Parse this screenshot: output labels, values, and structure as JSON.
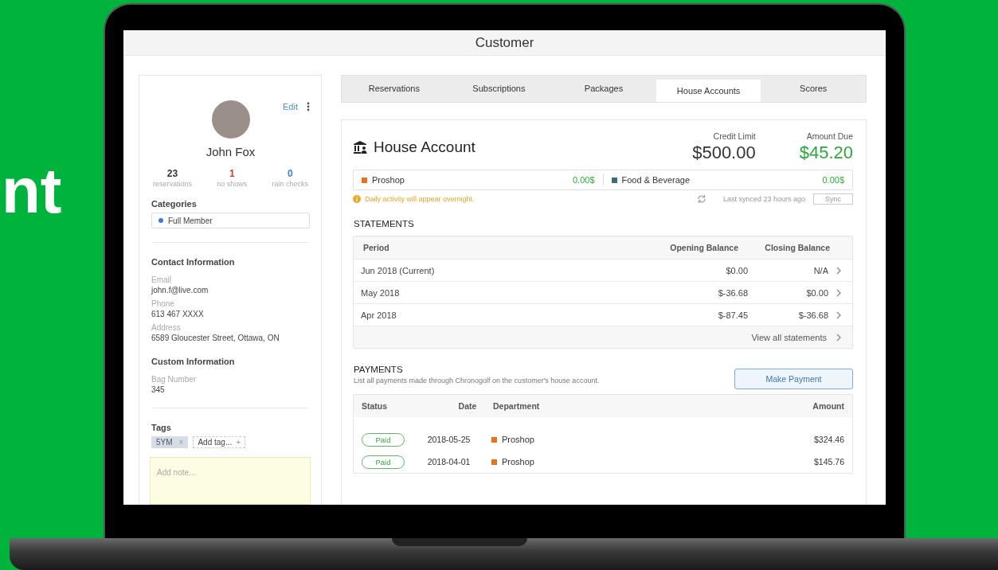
{
  "background": {
    "headline": "nt"
  },
  "window": {
    "title": "Customer"
  },
  "profile": {
    "edit_label": "Edit",
    "name": "John Fox",
    "stats": [
      {
        "value": "23",
        "label": "reservations",
        "color": "#333333"
      },
      {
        "value": "1",
        "label": "no shows",
        "color": "#d23a2f"
      },
      {
        "value": "0",
        "label": "rain checks",
        "color": "#3a86c8"
      }
    ]
  },
  "categories": {
    "title": "Categories",
    "items": [
      {
        "label": "Full Member",
        "color": "#3a7bd5"
      }
    ]
  },
  "contact": {
    "title": "Contact Information",
    "fields": [
      {
        "label": "Email",
        "value": "john.f@live.com"
      },
      {
        "label": "Phone",
        "value": "613 467 XXXX"
      },
      {
        "label": "Address",
        "value": "6589 Gloucester Street, Ottawa, ON"
      }
    ]
  },
  "custom": {
    "title": "Custom Information",
    "fields": [
      {
        "label": "Bag Number",
        "value": "345"
      }
    ]
  },
  "tags": {
    "title": "Tags",
    "items": [
      {
        "label": "5YM",
        "remove": "×"
      }
    ],
    "add_label": "Add tag...",
    "add_icon": "+"
  },
  "note": {
    "placeholder": "Add note..."
  },
  "tabs": [
    {
      "label": "Reservations",
      "selected": false
    },
    {
      "label": "Subscriptions",
      "selected": false
    },
    {
      "label": "Packages",
      "selected": false
    },
    {
      "label": "House Accounts",
      "selected": true
    },
    {
      "label": "Scores",
      "selected": false
    }
  ],
  "account": {
    "title": "House Account",
    "credit_limit": {
      "label": "Credit Limit",
      "value": "$500.00"
    },
    "amount_due": {
      "label": "Amount Due",
      "value": "$45.20"
    },
    "departments": [
      {
        "name": "Proshop",
        "amount": "0.00$",
        "color": "#e8731a"
      },
      {
        "name": "Food & Beverage",
        "amount": "0.00$",
        "color": "#3d6b7a"
      }
    ],
    "notice": "Daily activity will appear overnight.",
    "sync_status": "Last synced 23 hours ago",
    "sync_button": "Sync"
  },
  "statements": {
    "title": "STATEMENTS",
    "columns": [
      "Period",
      "Opening Balance",
      "Closing Balance"
    ],
    "rows": [
      {
        "period": "Jun 2018 (Current)",
        "opening": "$0.00",
        "closing": "N/A"
      },
      {
        "period": "May 2018",
        "opening": "$-36.68",
        "closing": "$0.00"
      },
      {
        "period": "Apr 2018",
        "opening": "$-87.45",
        "closing": "$-36.68"
      }
    ],
    "view_all": "View all statements"
  },
  "payments": {
    "title": "PAYMENTS",
    "description": "List all payments made through Chronogolf on the customer's house account.",
    "button": "Make Payment",
    "columns": [
      "Status",
      "Date",
      "Department",
      "Amount"
    ],
    "rows": [
      {
        "status": "Paid",
        "date": "2018-05-25",
        "department": "Proshop",
        "color": "#e8731a",
        "amount": "$324.46"
      },
      {
        "status": "Paid",
        "date": "2018-04-01",
        "department": "Proshop",
        "color": "#e8731a",
        "amount": "$145.76"
      }
    ]
  }
}
